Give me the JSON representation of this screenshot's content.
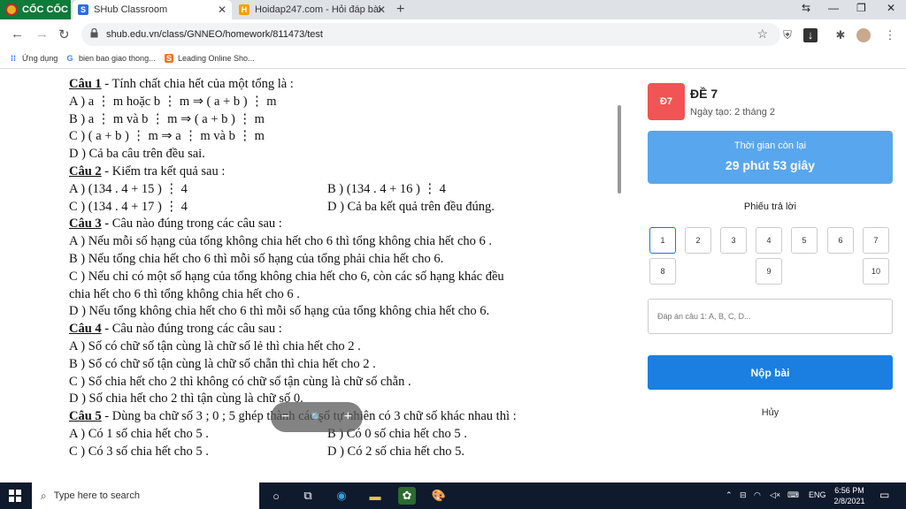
{
  "browser": {
    "brand": "CỐC CỐC",
    "tabs": [
      {
        "label": "SHub Classroom",
        "active": true
      },
      {
        "label": "Hoidap247.com - Hỏi đáp bài",
        "active": false
      }
    ],
    "new_tab": "+",
    "url": "shub.edu.vn/class/GNNEO/homework/811473/test",
    "bookmarks": [
      "Ứng dụng",
      "bien bao giao thong...",
      "Leading Online Sho..."
    ]
  },
  "document": {
    "lines": [
      {
        "q": "Câu 1",
        "text": " - Tính chất chia hết của một tổng là :"
      },
      {
        "text": "A )     a ⋮ m  hoặc  b ⋮ m  ⇒  ( a + b ) ⋮  m"
      },
      {
        "text": "B )     a ⋮ m  và  b ⋮ m  ⇒  ( a + b ) ⋮  m"
      },
      {
        "text": "C )     ( a + b ) ⋮  m  ⇒  a ⋮ m và  b ⋮  m"
      },
      {
        "text": "D ) Cả ba câu trên đều sai."
      },
      {
        "q": "Câu 2",
        "text": " -  Kiểm tra kết quả sau :"
      },
      {
        "text": "A )     (134 . 4 + 15 ) ⋮ 4",
        "text2": "B ) (134 . 4 + 16 ) ⋮ 4"
      },
      {
        "text": "C )     (134 . 4 + 17 ) ⋮ 4",
        "text2": "D ) Cả ba kết quả trên đều đúng."
      },
      {
        "q": "Câu 3",
        "text": " - Câu nào đúng trong các câu sau :"
      },
      {
        "text": "A )  Nếu mỗi số hạng của tổng không chia hết cho 6 thì tổng không chia hết cho 6 ."
      },
      {
        "text": "B )  Nếu tổng chia hết cho 6 thì mỗi số hạng của tổng phải chia hết cho 6."
      },
      {
        "text": "C )  Nếu chỉ có một số hạng của tổng không chia hết cho 6, còn các số hạng khác đều"
      },
      {
        "text": "        chia hết cho 6 thì tổng không chia hết cho 6 ."
      },
      {
        "text": "D )  Nếu tổng không chia hết cho 6 thì mỗi số hạng của tổng không chia hết cho 6."
      },
      {
        "q": "Câu 4",
        "text": " - Câu nào đúng trong các câu sau :"
      },
      {
        "text": "A )      Số có chữ số tận cùng là chữ số lẻ thì chia hết cho 2 ."
      },
      {
        "text": "B )       Số có chữ số tận cùng là chữ số chẵn thì chia hết cho 2 ."
      },
      {
        "text": "C )       Số chia hết cho 2 thì không  có chữ số tận cùng là chữ số chẵn ."
      },
      {
        "text": "D )      Số chia hết cho 2 thì tận cùng là chữ số 0."
      },
      {
        "q": "Câu 5",
        "text": " - Dùng ba chữ  số 3 ; 0 ; 5 ghép thành các số tự nhiên có 3 chữ số khác nhau thì :"
      },
      {
        "text": "A )     Có 1  số chia hết cho 5 .",
        "text2": "B )     Có 0  số chia hết cho 5 ."
      },
      {
        "text": "C )     Có 3  số chia hết cho 5 .",
        "text2": "D )     Có 2  số chia hết cho 5."
      }
    ]
  },
  "zoom": {
    "minus": "−",
    "search": "🔍",
    "plus": "+"
  },
  "exam": {
    "badge": "Đ7",
    "title": "ĐỀ 7",
    "created": "Ngày tạo: 2 tháng 2",
    "timer_label": "Thời gian còn lại",
    "timer_value": "29 phút 53 giây",
    "sheet_title": "Phiếu trả lời",
    "questions": [
      "1",
      "2",
      "3",
      "4",
      "5",
      "6",
      "7",
      "8",
      "9",
      "10"
    ],
    "answer_placeholder": "Đáp án câu 1: A, B, C, D...",
    "submit_label": "Nộp bài",
    "cancel_label": "Hủy"
  },
  "taskbar": {
    "search_placeholder": "Type here to search",
    "lang": "ENG",
    "time": "6:56 PM",
    "date": "2/8/2021"
  }
}
